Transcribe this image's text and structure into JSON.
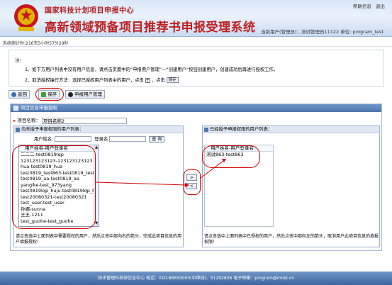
{
  "header": {
    "org": "国家科技计划项目申报中心",
    "title": "高新领域预备项目推荐书申报受理系统",
    "links": [
      "帮助信息",
      "退出"
    ],
    "user_info": "当前用户(管理员)：测试管理员11122    单位: program_test"
  },
  "status": {
    "timer": "系统倒计时:216天5小时57分29秒"
  },
  "note": {
    "intro": "注：",
    "line1": "1、如下方用户列表中没有用户信息，请点击页面中的“申报用户管理”—“创建用户”按钮创建用户，创建成功后再进行授权工作。",
    "line2_a": "2、取消授权操作方法：选择已授权用户列表中的用户，点击",
    "line2_plus": "+",
    "line2_b": "，点击",
    "line2_btn": "保存"
  },
  "toolbar": {
    "back": "返回",
    "save": "保存",
    "user_mgmt": "申报用户管理"
  },
  "panel": {
    "title": "项目信息申报授权",
    "project_label": "项目名称：",
    "project_value": "项目名称2"
  },
  "left": {
    "header": "尚未授予申报权限的用户列表：",
    "name_label": "用户姓名:",
    "login_label": "登录名",
    "search_btn": "查 询",
    "list_header": "用户姓名-用户登录名",
    "items": [
      "二二二-test0819lqp",
      "123123123123-123123123123",
      "hua-test0819_hua",
      "test0819_test863-test0819_test863",
      "test0819_aa-test0819_aa",
      "yangike-test_973yang",
      "test0819lqp_huju-test0819lqp_huju",
      "test20080321-test20080321",
      "test_user-test_user",
      "孙娜-sunna",
      "王王-1211",
      "test_guohe-test_guohe"
    ],
    "footer": "请点击选中上面列表中需要授权的用户，然后点击中部向右的箭头，完成此项目信息的用户填报授权！"
  },
  "arrows": {
    "right": ">",
    "left": "<"
  },
  "right": {
    "header": "已经授予申报权限的用户列表：",
    "list_header": "用户姓名-用户登录名",
    "items": [
      "测试863-test863"
    ],
    "footer": "请点击选中上面列表中已授权的用户，然后点击中部向左的箭头，取消用户此项目信息的填报权限！"
  },
  "footer": {
    "text": "技术管理科技部信息中心  电话：010-88659000(中继线)、51292836  电子邮箱：program@most.cn"
  }
}
